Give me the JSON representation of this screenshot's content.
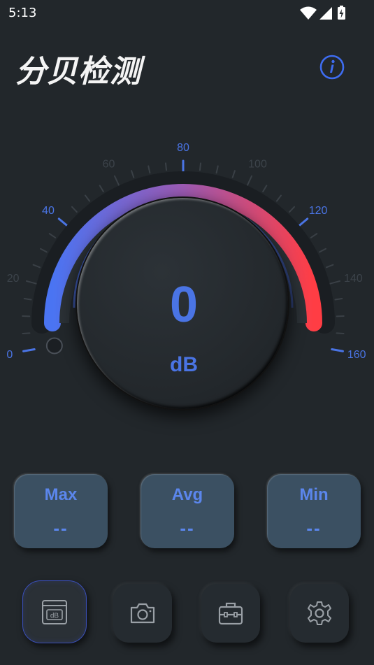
{
  "status_bar": {
    "time": "5:13",
    "icons": [
      "wifi-icon",
      "cellular-signal-icon",
      "battery-charging-icon"
    ]
  },
  "header": {
    "title": "分贝检测",
    "info_icon": "info-icon"
  },
  "gauge": {
    "scale_labels": [
      "0",
      "20",
      "40",
      "60",
      "80",
      "100",
      "120",
      "140",
      "160"
    ],
    "min": 0,
    "max": 160,
    "current_level": 0,
    "reading_value": "0",
    "reading_unit": "dB",
    "arc_gradient": [
      "#4a74f2",
      "#9d5bb5",
      "#ff3d44"
    ],
    "accent_color": "#4a74e4"
  },
  "stats": [
    {
      "label": "Max",
      "value": "--"
    },
    {
      "label": "Avg",
      "value": "--"
    },
    {
      "label": "Min",
      "value": "--"
    }
  ],
  "bottom_nav": [
    {
      "icon": "decibel-meter-icon",
      "active": true
    },
    {
      "icon": "camera-icon",
      "active": false
    },
    {
      "icon": "toolbox-icon",
      "active": false
    },
    {
      "icon": "settings-gear-icon",
      "active": false
    }
  ]
}
